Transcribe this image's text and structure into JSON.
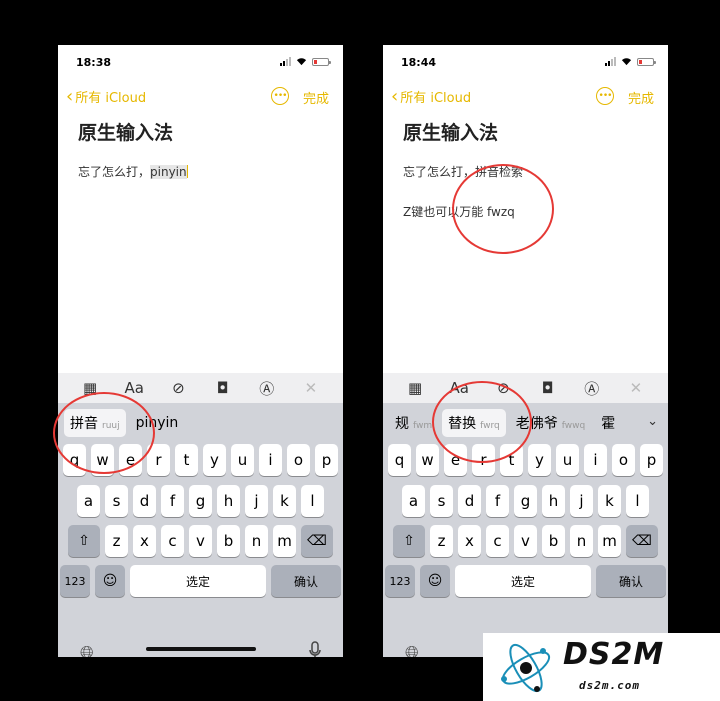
{
  "left": {
    "time": "18:38",
    "nav": {
      "back_label": "所有 iCloud",
      "done_label": "完成"
    },
    "note": {
      "title": "原生输入法",
      "line1_text": "忘了怎么打，",
      "line1_selected": "pinyin"
    },
    "candidates": [
      {
        "word": "拼音",
        "code": "ruuj"
      },
      {
        "word": "pinyin",
        "code": ""
      }
    ],
    "keys": {
      "row1": [
        "q",
        "w",
        "e",
        "r",
        "t",
        "y",
        "u",
        "i",
        "o",
        "p"
      ],
      "row2": [
        "a",
        "s",
        "d",
        "f",
        "g",
        "h",
        "j",
        "k",
        "l"
      ],
      "row3": [
        "z",
        "x",
        "c",
        "v",
        "b",
        "n",
        "m"
      ],
      "num": "123",
      "space": "选定",
      "confirm": "确认"
    }
  },
  "right": {
    "time": "18:44",
    "nav": {
      "back_label": "所有 iCloud",
      "done_label": "完成"
    },
    "note": {
      "title": "原生输入法",
      "line1": "忘了怎么打，拼音检索",
      "line2": "Z键也可以万能 fwzq"
    },
    "candidates": [
      {
        "word": "规",
        "code": "fwm"
      },
      {
        "word": "替换",
        "code": "fwrq"
      },
      {
        "word": "老佛爷",
        "code": "fwwq"
      },
      {
        "word": "霍",
        "code": ""
      }
    ],
    "keys": {
      "row1": [
        "q",
        "w",
        "e",
        "r",
        "t",
        "y",
        "u",
        "i",
        "o",
        "p"
      ],
      "row2": [
        "a",
        "s",
        "d",
        "f",
        "g",
        "h",
        "j",
        "k",
        "l"
      ],
      "row3": [
        "z",
        "x",
        "c",
        "v",
        "b",
        "n",
        "m"
      ],
      "num": "123",
      "space": "选定",
      "confirm": "确认"
    }
  },
  "logo": {
    "brand": "DS2M",
    "url": "ds2m.com"
  },
  "colors": {
    "accent": "#e6b800",
    "annotation": "#e53935",
    "keyboard_bg": "#d1d3d9"
  },
  "icons": [
    "chevron-left-icon",
    "more-icon",
    "table-icon",
    "format-icon",
    "checklist-icon",
    "camera-icon",
    "markup-icon",
    "close-icon",
    "shift-icon",
    "delete-icon",
    "emoji-icon",
    "globe-icon",
    "microphone-icon",
    "chevron-down-icon"
  ]
}
